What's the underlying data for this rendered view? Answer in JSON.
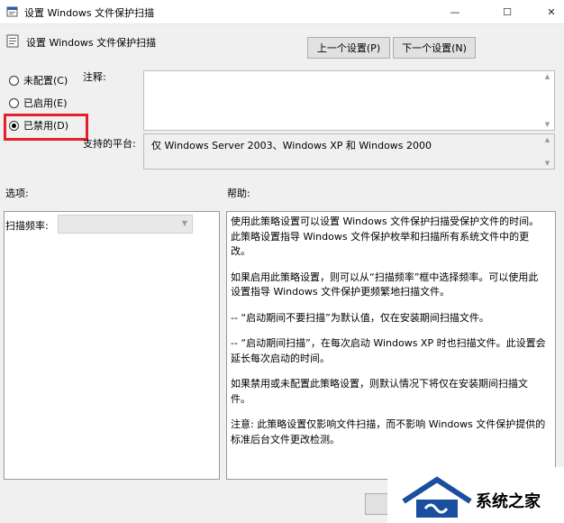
{
  "window": {
    "title": "设置 Windows 文件保护扫描",
    "controls": {
      "minimize": "—",
      "maximize": "☐",
      "close": "✕"
    }
  },
  "header": {
    "policy_title": "设置 Windows 文件保护扫描",
    "prev_button": "上一个设置(P)",
    "next_button": "下一个设置(N)"
  },
  "state": {
    "options": [
      {
        "label": "未配置(C)",
        "checked": false
      },
      {
        "label": "已启用(E)",
        "checked": false
      },
      {
        "label": "已禁用(D)",
        "checked": true
      }
    ],
    "highlight_color": "#e3202b"
  },
  "comment": {
    "label": "注释:",
    "value": ""
  },
  "platform": {
    "label": "支持的平台:",
    "value": "仅 Windows Server 2003、Windows XP 和 Windows 2000"
  },
  "options_section": {
    "label": "选项:",
    "frequency_label": "扫描频率:",
    "frequency_value": ""
  },
  "help_section": {
    "label": "帮助:",
    "paragraphs": [
      "使用此策略设置可以设置 Windows 文件保护扫描受保护文件的时间。此策略设置指导 Windows 文件保护枚举和扫描所有系统文件中的更改。",
      "如果启用此策略设置，则可以从“扫描频率”框中选择频率。可以使用此设置指导 Windows 文件保护更频繁地扫描文件。",
      "-- “启动期间不要扫描”为默认值，仅在安装期间扫描文件。",
      "-- “启动期间扫描”，在每次启动 Windows XP 时也扫描文件。此设置会延长每次启动的时间。",
      "如果禁用或未配置此策略设置，则默认情况下将仅在安装期间扫描文件。",
      "注意: 此策略设置仅影响文件扫描，而不影响 Windows 文件保护提供的标准后台文件更改检测。"
    ]
  },
  "watermark": {
    "text": "系统之家"
  }
}
